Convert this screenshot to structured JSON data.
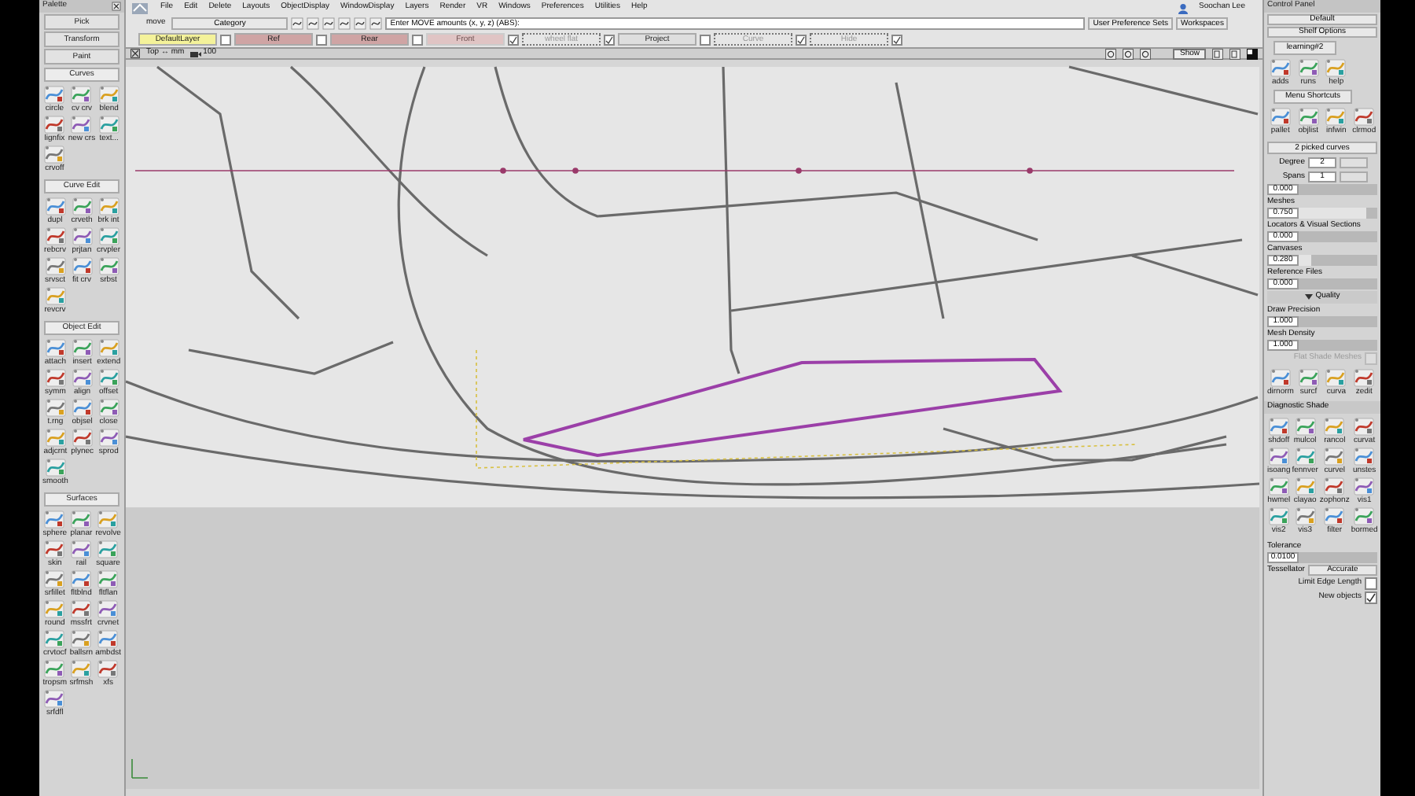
{
  "palette": {
    "title": "Palette",
    "buttons": [
      "Pick",
      "Transform",
      "Paint"
    ],
    "groups": [
      {
        "title": "Curves",
        "tools": [
          "circle",
          "cv crv",
          "blend",
          "lignfix",
          "new crs",
          "text...",
          "crvoff"
        ]
      },
      {
        "title": "Curve Edit",
        "tools": [
          "dupl",
          "crveth",
          "brk int",
          "rebcrv",
          "prjtan",
          "crvpler",
          "srvsct",
          "fit crv",
          "srbst",
          "revcrv"
        ]
      },
      {
        "title": "Object Edit",
        "tools": [
          "attach",
          "insert",
          "extend",
          "symm",
          "align",
          "offset",
          "t.rng",
          "objsel",
          "close",
          "adjcrnt",
          "plynec",
          "sprod",
          "smooth"
        ]
      },
      {
        "title": "Surfaces",
        "tools": [
          "sphere",
          "planar",
          "revolve",
          "skin",
          "rail",
          "square",
          "srfillet",
          "fltblnd",
          "fltflan",
          "round",
          "mssfrt",
          "crvnet",
          "crvtocf",
          "ballsrn",
          "ambdst",
          "tropsm",
          "srfmsh",
          "xfs",
          "srfdfl"
        ]
      }
    ]
  },
  "menu_bar": {
    "tool_label": "move",
    "items": [
      "File",
      "Edit",
      "Delete",
      "Layouts",
      "ObjectDisplay",
      "WindowDisplay",
      "Layers",
      "Render",
      "VR",
      "Windows",
      "Preferences",
      "Utilities",
      "Help"
    ],
    "user": "Soochan Lee"
  },
  "toolbar": {
    "category": "Category",
    "prompt": "Enter MOVE amounts (x, y, z) (ABS):",
    "buttons": [
      "User Preference Sets",
      "Workspaces"
    ]
  },
  "layers": [
    {
      "label": "DefaultLayer",
      "kind": "current",
      "checked": false
    },
    {
      "label": "Ref",
      "kind": "pink",
      "checked": false
    },
    {
      "label": "Rear",
      "kind": "pink",
      "checked": false
    },
    {
      "label": "Front",
      "kind": "faded",
      "checked": true
    },
    {
      "label": "wheel flat",
      "kind": "dotted",
      "checked": true
    },
    {
      "label": "Project",
      "kind": "plain",
      "checked": false
    },
    {
      "label": "Curve",
      "kind": "dotted",
      "checked": true
    },
    {
      "label": "Hide",
      "kind": "dotted",
      "checked": true
    }
  ],
  "viewport": {
    "view": "Top ↔ mm",
    "zoom": "100",
    "show_button": "Show"
  },
  "control_panel": {
    "title": "Control Panel",
    "shelf_set": "Default",
    "shelf_options": "Shelf Options",
    "shelf_tab": "learning#2",
    "shelf_tools": [
      "adds",
      "runs",
      "help"
    ],
    "shortcuts_title": "Menu Shortcuts",
    "shortcuts": [
      "pallet",
      "objlist",
      "infwin",
      "clrmod"
    ],
    "selection": "2 picked curves",
    "rows": [
      {
        "kind": "pair",
        "label": "Degree",
        "value": "2"
      },
      {
        "kind": "pair",
        "label": "Spans",
        "value": "1"
      },
      {
        "kind": "slider",
        "value": "0.000",
        "level": 0
      },
      {
        "kind": "label",
        "label": "Meshes"
      },
      {
        "kind": "slider",
        "value": "0.750",
        "level": 0.85
      },
      {
        "kind": "label",
        "label": "Locators & Visual Sections"
      },
      {
        "kind": "slider",
        "value": "0.000",
        "level": 0
      },
      {
        "kind": "label",
        "label": "Canvases"
      },
      {
        "kind": "slider",
        "value": "0.280",
        "level": 0.15
      },
      {
        "kind": "label",
        "label": "Reference Files"
      },
      {
        "kind": "slider",
        "value": "0.000",
        "level": 0
      },
      {
        "kind": "section",
        "label": "Quality",
        "expanded": true
      },
      {
        "kind": "label",
        "label": "Draw Precision"
      },
      {
        "kind": "slider",
        "value": "1.000",
        "level": 0
      },
      {
        "kind": "label",
        "label": "Mesh Density"
      },
      {
        "kind": "slider",
        "value": "1.000",
        "level": 0
      },
      {
        "kind": "check",
        "label": "Flat Shade Meshes",
        "checked": false,
        "disabled": true
      }
    ],
    "extra_tools": [
      "dirnorm",
      "surcf",
      "curva",
      "zedit"
    ],
    "diagnostic_title": "Diagnostic Shade",
    "diagnostic_tools": [
      "shdoff",
      "mulcol",
      "rancol",
      "curvat",
      "isoang",
      "fennver",
      "curvel",
      "unstes",
      "hwmel",
      "clayao",
      "zophonz",
      "vis1",
      "vis2",
      "vis3",
      "filter",
      "bormed"
    ],
    "bottom_rows": [
      {
        "kind": "label",
        "label": "Tolerance"
      },
      {
        "kind": "slider",
        "value": "0.0100",
        "level": 0
      },
      {
        "kind": "select",
        "label": "Tessellator",
        "value": "Accurate"
      },
      {
        "kind": "check",
        "label": "Limit Edge Length",
        "checked": false,
        "disabled": false
      },
      {
        "kind": "check",
        "label": "New objects",
        "checked": true,
        "disabled": false
      }
    ]
  }
}
